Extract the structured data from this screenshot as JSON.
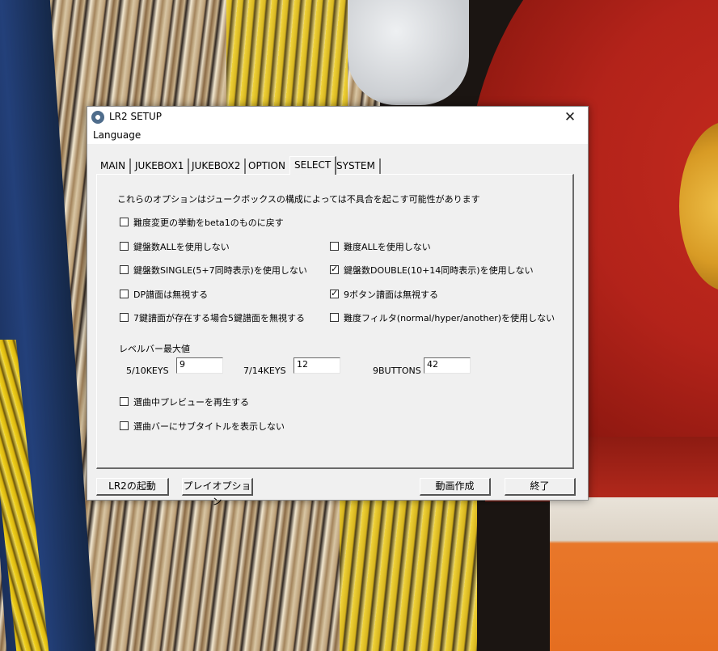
{
  "window": {
    "title": "LR2 SETUP",
    "close_glyph": "✕",
    "icon": "lr2-app-icon"
  },
  "menu": {
    "language": "Language"
  },
  "tabs": [
    {
      "label": "MAIN",
      "active": false
    },
    {
      "label": "JUKEBOX1",
      "active": false
    },
    {
      "label": "JUKEBOX2",
      "active": false
    },
    {
      "label": "OPTION",
      "active": false
    },
    {
      "label": "SELECT",
      "active": true
    },
    {
      "label": "SYSTEM",
      "active": false
    }
  ],
  "select": {
    "notice": "これらのオプションはジュークボックスの構成によっては不具合を起こす可能性があります",
    "options": [
      {
        "label": "難度変更の挙動をbeta1のものに戻す",
        "checked": false
      },
      {
        "label": "鍵盤数ALLを使用しない",
        "checked": false
      },
      {
        "label": "難度ALLを使用しない",
        "checked": false
      },
      {
        "label": "鍵盤数SINGLE(5+7同時表示)を使用しない",
        "checked": false
      },
      {
        "label": "鍵盤数DOUBLE(10+14同時表示)を使用しない",
        "checked": true
      },
      {
        "label": "DP譜面は無視する",
        "checked": false
      },
      {
        "label": "9ボタン譜面は無視する",
        "checked": true
      },
      {
        "label": "7鍵譜面が存在する場合5鍵譜面を無視する",
        "checked": false
      },
      {
        "label": "難度フィルタ(normal/hyper/another)を使用しない",
        "checked": false
      },
      {
        "label": "選曲中プレビューを再生する",
        "checked": false
      },
      {
        "label": "選曲バーにサブタイトルを表示しない",
        "checked": false
      }
    ],
    "check_glyph": "✓",
    "level_bar": {
      "heading": "レベルバー最大値",
      "fields": [
        {
          "label": "5/10KEYS",
          "value": "9"
        },
        {
          "label": "7/14KEYS",
          "value": "12"
        },
        {
          "label": "9BUTTONS",
          "value": "42"
        }
      ]
    }
  },
  "buttons": {
    "launch": "LR2の起動",
    "play_option": "プレイオプション",
    "make_movie": "動画作成",
    "exit": "終了"
  }
}
